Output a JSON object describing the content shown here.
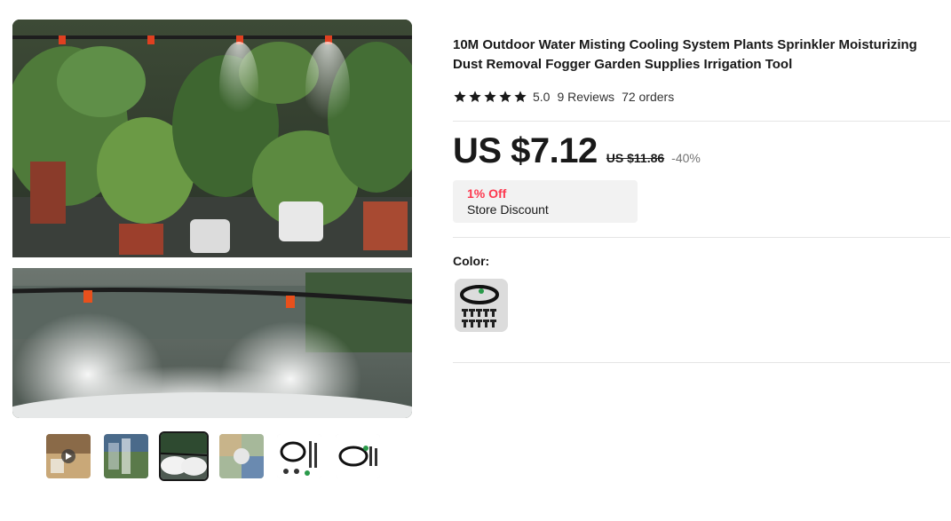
{
  "product": {
    "title": "10M Outdoor Water Misting Cooling System Plants Sprinkler Moisturizing Dust Removal Fogger Garden Supplies Irrigation Tool",
    "rating": {
      "stars": 5,
      "value": "5.0",
      "reviews_label": "9 Reviews",
      "orders_label": "72 orders"
    },
    "price": {
      "current": "US $7.12",
      "original": "US $11.86",
      "discount": "-40%"
    },
    "store_discount": {
      "off_label": "1% Off",
      "label": "Store Discount"
    },
    "color": {
      "label": "Color:",
      "selected_option": "misting-kit-swatch"
    }
  },
  "gallery": {
    "main_image": "garden-misting-photo",
    "thumbnails": [
      {
        "name": "thumb-video",
        "icon": "play-icon",
        "active": false
      },
      {
        "name": "thumb-2",
        "active": false
      },
      {
        "name": "thumb-3",
        "active": true
      },
      {
        "name": "thumb-4",
        "active": false
      },
      {
        "name": "thumb-5",
        "active": false
      },
      {
        "name": "thumb-6",
        "active": false
      }
    ]
  },
  "colors": {
    "price": "#191919",
    "discount_red": "#fd384f",
    "muted": "#757575",
    "divider": "#e5e5e5",
    "box_bg": "#f2f2f2"
  }
}
